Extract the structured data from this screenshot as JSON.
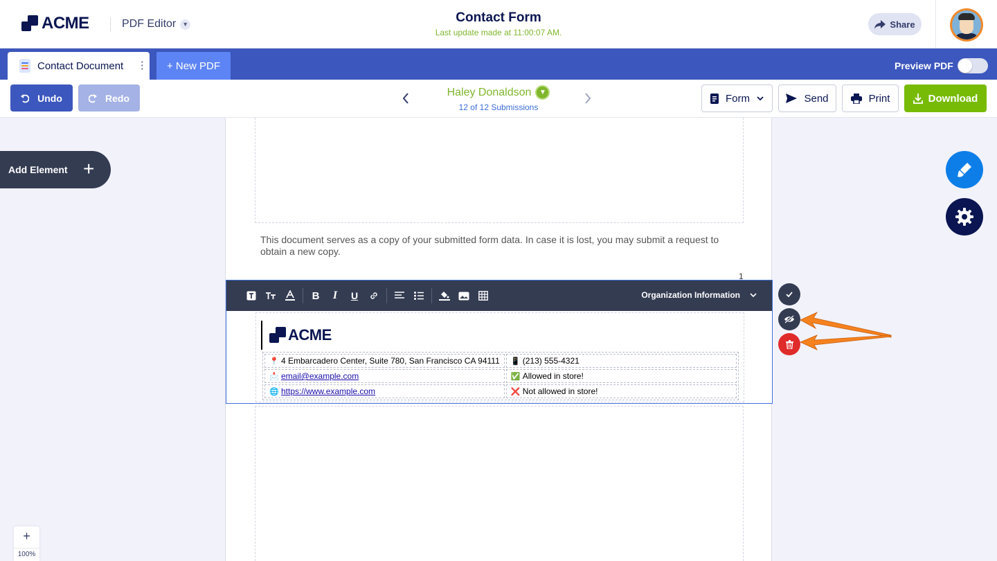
{
  "header": {
    "brand": "ACME",
    "app_name": "PDF Editor",
    "title": "Contact Form",
    "subtitle": "Last update made at 11:00:07 AM.",
    "share_label": "Share"
  },
  "tabs": {
    "active_label": "Contact Document",
    "new_label": "+ New PDF",
    "preview_label": "Preview PDF",
    "preview_enabled": false
  },
  "toolbar": {
    "undo_label": "Undo",
    "redo_label": "Redo",
    "submitter_name": "Haley Donaldson",
    "submission_count": "12 of 12 Submissions",
    "form_label": "Form",
    "send_label": "Send",
    "print_label": "Print",
    "download_label": "Download"
  },
  "sidebar": {
    "add_element_label": "Add Element",
    "zoom_label": "100%",
    "zoom_in_label": "+"
  },
  "document": {
    "notice": "This document serves as a copy of your submitted form data. In case it is lost, you may submit a request to obtain a new copy.",
    "page_number": "1",
    "section_name": "Organization Information",
    "org_brand": "ACME",
    "rows": [
      {
        "left_icon": "📍",
        "left": "4 Embarcadero Center, Suite 780, San Francisco CA 94111",
        "right_icon": "📱",
        "right": "(213) 555-4321"
      },
      {
        "left_icon": "📩",
        "left": "email@example.com",
        "right_icon": "✅",
        "right": "Allowed in store!"
      },
      {
        "left_icon": "🌐",
        "left": "https://www.example.com",
        "right_icon": "❌",
        "right": "Not allowed in store!"
      }
    ]
  },
  "colors": {
    "brand_dark": "#0a1551",
    "tab_bar": "#3c57bd",
    "download": "#78bb07",
    "delete": "#e02b2b",
    "annotation_arrow": "#f5821f"
  }
}
